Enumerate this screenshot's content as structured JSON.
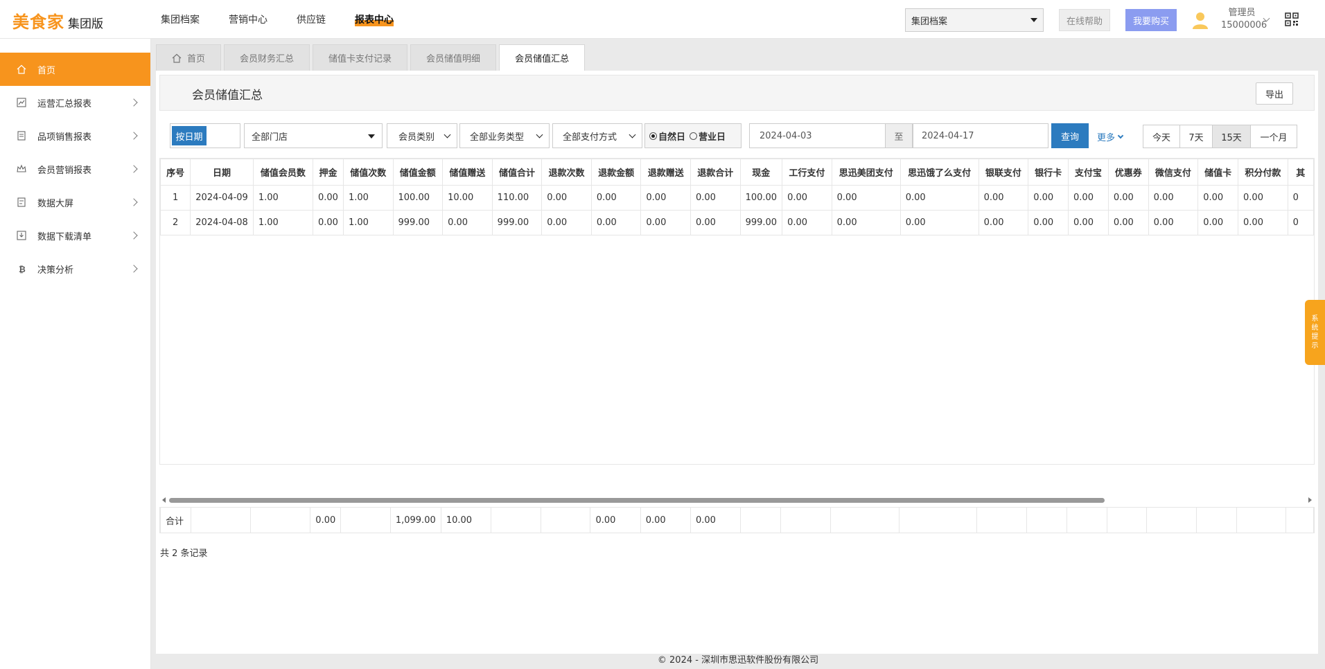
{
  "brand": {
    "name": "美食家",
    "edition": "集团版",
    "color": "#f7941d"
  },
  "topnav": [
    {
      "label": "集团档案",
      "active": false
    },
    {
      "label": "营销中心",
      "active": false
    },
    {
      "label": "供应链",
      "active": false
    },
    {
      "label": "报表中心",
      "active": true
    }
  ],
  "header": {
    "org_select": "集团档案",
    "help_label": "在线帮助",
    "buy_label": "我要购买",
    "user_role": "管理员",
    "user_id": "15000006"
  },
  "sidebar": {
    "items": [
      {
        "label": "首页",
        "icon": "home-icon",
        "active": true
      },
      {
        "label": "运营汇总报表",
        "icon": "chart-icon",
        "active": false
      },
      {
        "label": "品项销售报表",
        "icon": "document-icon",
        "active": false
      },
      {
        "label": "会员营销报表",
        "icon": "crown-icon",
        "active": false
      },
      {
        "label": "数据大屏",
        "icon": "screen-icon",
        "active": false
      },
      {
        "label": "数据下载清单",
        "icon": "download-icon",
        "active": false
      },
      {
        "label": "决策分析",
        "icon": "bitcoin-icon",
        "active": false
      }
    ]
  },
  "tabs": [
    {
      "label": "首页",
      "active": false
    },
    {
      "label": "会员财务汇总",
      "active": false
    },
    {
      "label": "储值卡支付记录",
      "active": false
    },
    {
      "label": "会员储值明细",
      "active": false
    },
    {
      "label": "会员储值汇总",
      "active": true
    }
  ],
  "page": {
    "title": "会员储值汇总",
    "export_label": "导出"
  },
  "filters": {
    "date_mode": "按日期",
    "store": "全部门店",
    "member_type": "会员类别",
    "business_type": "全部业务类型",
    "payment_method": "全部支付方式",
    "radio_natural": "自然日",
    "radio_business": "营业日",
    "start_date": "2024-04-03",
    "to_label": "至",
    "end_date": "2024-04-17",
    "query_label": "查询",
    "more_label": "更多",
    "ranges": [
      {
        "label": "今天",
        "active": false
      },
      {
        "label": "7天",
        "active": false
      },
      {
        "label": "15天",
        "active": true
      },
      {
        "label": "一个月",
        "active": false
      }
    ]
  },
  "table": {
    "columns": [
      "序号",
      "日期",
      "储值会员数",
      "押金",
      "储值次数",
      "储值金额",
      "储值赠送",
      "储值合计",
      "退款次数",
      "退款金额",
      "退款赠送",
      "退款合计",
      "现金",
      "工行支付",
      "思迅美团支付",
      "思迅饿了么支付",
      "银联支付",
      "银行卡",
      "支付宝",
      "优惠券",
      "微信支付",
      "储值卡",
      "积分付款",
      "其"
    ],
    "rows": [
      [
        "1",
        "2024-04-09",
        "1.00",
        "0.00",
        "1.00",
        "100.00",
        "10.00",
        "110.00",
        "0.00",
        "0.00",
        "0.00",
        "0.00",
        "100.00",
        "0.00",
        "0.00",
        "0.00",
        "0.00",
        "0.00",
        "0.00",
        "0.00",
        "0.00",
        "0.00",
        "0.00",
        "0"
      ],
      [
        "2",
        "2024-04-08",
        "1.00",
        "0.00",
        "1.00",
        "999.00",
        "0.00",
        "999.00",
        "0.00",
        "0.00",
        "0.00",
        "0.00",
        "999.00",
        "0.00",
        "0.00",
        "0.00",
        "0.00",
        "0.00",
        "0.00",
        "0.00",
        "0.00",
        "0.00",
        "0.00",
        "0"
      ]
    ],
    "totals": [
      "合计",
      "",
      "",
      "0.00",
      "",
      "1,099.00",
      "10.00",
      "",
      "",
      "0.00",
      "0.00",
      "0.00",
      "",
      "",
      "",
      "",
      "",
      "",
      "",
      "",
      "",
      "",
      "",
      ""
    ],
    "record_count": "共 2 条记录"
  },
  "system_tip": "系统提示",
  "footer": "© 2024 - 深圳市思迅软件股份有限公司"
}
